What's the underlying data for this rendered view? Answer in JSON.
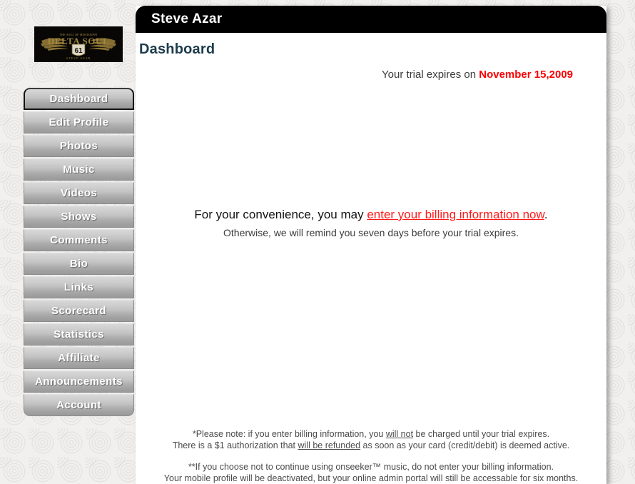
{
  "sidebar": {
    "logo": {
      "icon": "winged-emblem-logo",
      "brand_top": "THE SOUL OF MISSISSIPPI",
      "brand_main": "DELTA SOUL",
      "brand_shield": "61",
      "brand_sub": "STEVE AZAR"
    },
    "items": [
      {
        "label": "Dashboard",
        "name": "dashboard",
        "active": true
      },
      {
        "label": "Edit Profile",
        "name": "edit-profile",
        "active": false
      },
      {
        "label": "Photos",
        "name": "photos",
        "active": false
      },
      {
        "label": "Music",
        "name": "music",
        "active": false
      },
      {
        "label": "Videos",
        "name": "videos",
        "active": false
      },
      {
        "label": "Shows",
        "name": "shows",
        "active": false
      },
      {
        "label": "Comments",
        "name": "comments",
        "active": false
      },
      {
        "label": "Bio",
        "name": "bio",
        "active": false
      },
      {
        "label": "Links",
        "name": "links",
        "active": false
      },
      {
        "label": "Scorecard",
        "name": "scorecard",
        "active": false
      },
      {
        "label": "Statistics",
        "name": "statistics",
        "active": false
      },
      {
        "label": "Affiliate",
        "name": "affiliate",
        "active": false
      },
      {
        "label": "Announcements",
        "name": "announcements",
        "active": false
      },
      {
        "label": "Account",
        "name": "account",
        "active": false
      }
    ]
  },
  "header": {
    "title": "Steve Azar"
  },
  "main": {
    "page_title": "Dashboard",
    "trial": {
      "prefix": "Your trial expires on",
      "date": "November 15,2009"
    },
    "billing": {
      "line1_before": "For your convenience, you may ",
      "link_text": "enter your billing information now",
      "line1_after": ".",
      "line2": "Otherwise, we will remind you seven days before your trial expires."
    },
    "footnotes": {
      "note1_a": "*Please note: if you enter billing information, you ",
      "note1_u": "will not",
      "note1_b": " be charged until your trial expires.",
      "note2_a": "There is a $1 authorization that ",
      "note2_u": "will be refunded",
      "note2_b": " as soon as your card (credit/debit) is deemed active.",
      "note3": "**If you choose not to continue using onseeker™ music, do not enter your billing information.",
      "note4": "Your mobile profile will be deactivated, but your online admin portal will still be accessable for six months."
    }
  },
  "colors": {
    "title_bar": "#000000",
    "page_title": "#1d3c4d",
    "trial_date": "#fa0000",
    "billing_link": "#ff1a1a",
    "panel_bg": "#ffffff",
    "page_bg": "#f1f0ee",
    "nav_text": "#ffffff"
  }
}
